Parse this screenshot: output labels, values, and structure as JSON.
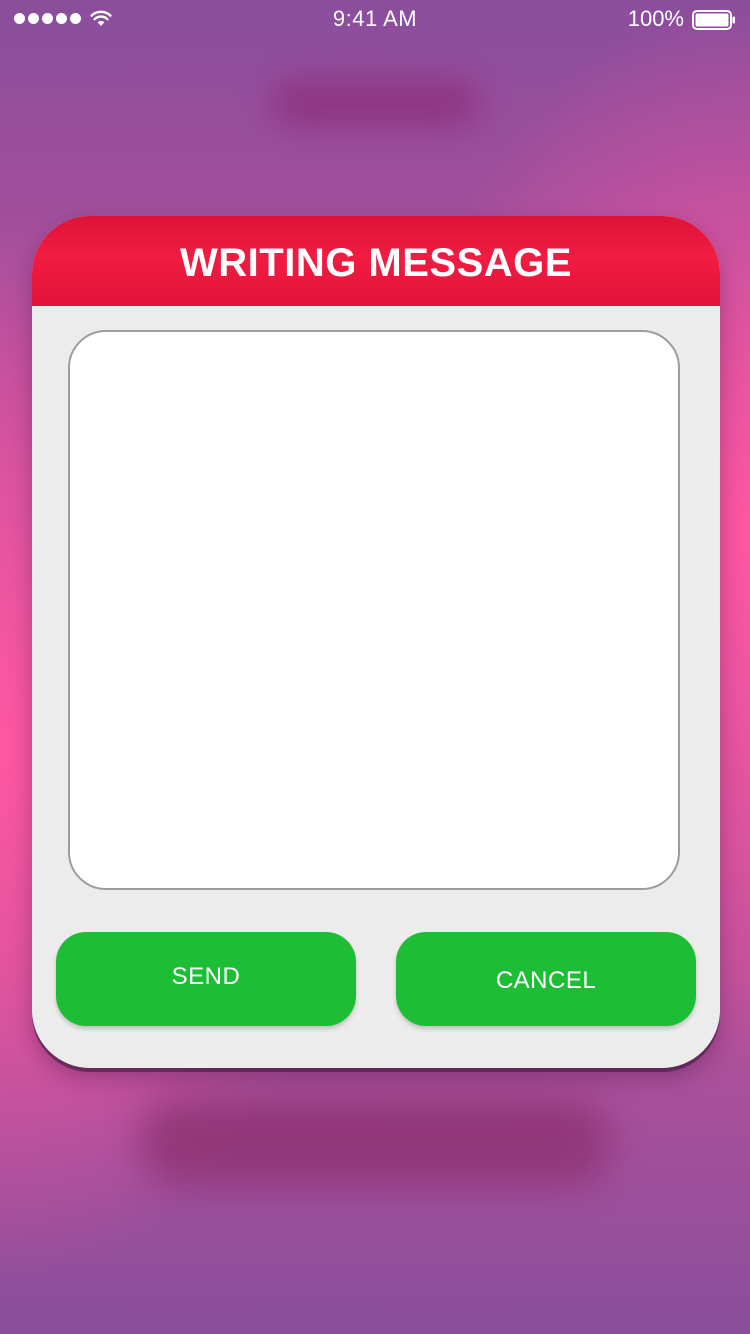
{
  "status_bar": {
    "time": "9:41 AM",
    "battery_percent": "100%",
    "signal_dots": 5,
    "icons": [
      "signal-dots-icon",
      "wifi-icon",
      "battery-icon"
    ]
  },
  "modal": {
    "title": "WRITING MESSAGE",
    "message": {
      "value": "",
      "placeholder": ""
    },
    "send_label": "SEND",
    "cancel_label": "CANCEL"
  },
  "colors": {
    "header_red": "#f01c42",
    "button_green": "#1dbe36",
    "panel_gray": "#ececec",
    "background_pink": "#ff56a3",
    "background_purple": "#8a4e9d"
  }
}
